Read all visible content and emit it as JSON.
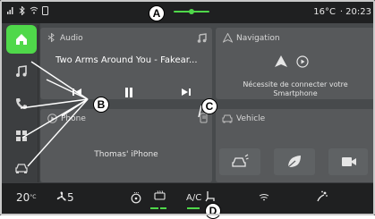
{
  "status": {
    "temperature": "16°C",
    "separator": "·",
    "time": "20:23",
    "icons": [
      "signal-icon",
      "bluetooth-icon",
      "wifi-icon",
      "phone-status-icon"
    ]
  },
  "sidebar": {
    "items": [
      {
        "name": "home",
        "icon": "home-icon",
        "active": true
      },
      {
        "name": "music",
        "icon": "music-note-icon",
        "active": false
      },
      {
        "name": "phone",
        "icon": "phone-icon",
        "active": false
      },
      {
        "name": "apps",
        "icon": "apps-grid-icon",
        "active": false
      },
      {
        "name": "vehicle",
        "icon": "car-icon",
        "active": false
      }
    ]
  },
  "widgets": {
    "audio": {
      "title": "Audio",
      "track": "Two Arms Around You - Fakear..."
    },
    "navigation": {
      "title": "Navigation",
      "message": "Nécessite de connecter votre Smartphone"
    },
    "phone": {
      "title": "Phone",
      "device": "Thomas' iPhone"
    },
    "vehicle": {
      "title": "Vehicle"
    }
  },
  "bottom_bar": {
    "left_temp": "20",
    "left_temp_sup": "°C",
    "fan_level": "5",
    "ac_label": "A/C"
  },
  "callouts": {
    "a": "A",
    "b": "B",
    "c": "C",
    "d": "D"
  },
  "colors": {
    "accent": "#4fd84a",
    "background": "#3c3e40",
    "widget": "#57595b"
  }
}
